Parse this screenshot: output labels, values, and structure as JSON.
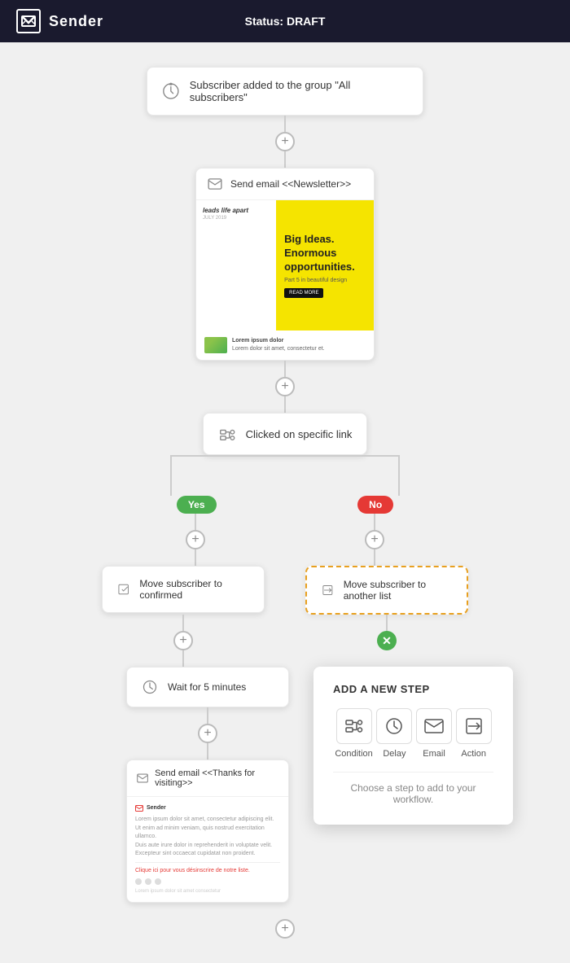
{
  "header": {
    "logo_text": "Sender",
    "status_label": "Status:",
    "status_value": "DRAFT"
  },
  "nodes": {
    "trigger": {
      "label": "Subscriber added to the group \"All subscribers\""
    },
    "send_email": {
      "label": "Send email <<Newsletter>>"
    },
    "condition": {
      "label": "Clicked on specific link"
    },
    "branch_yes": "Yes",
    "branch_no": "No",
    "move_confirmed": {
      "label": "Move subscriber to confirmed"
    },
    "move_another_list": {
      "label": "Move subscriber to another list"
    },
    "wait": {
      "label": "Wait for 5 minutes"
    },
    "send_email2": {
      "label": "Send email <<Thanks for visiting>>"
    }
  },
  "add_new_step": {
    "title": "ADD A NEW STEP",
    "steps": [
      {
        "key": "condition",
        "label": "Condition",
        "icon": "condition"
      },
      {
        "key": "delay",
        "label": "Delay",
        "icon": "delay"
      },
      {
        "key": "email",
        "label": "Email",
        "icon": "email"
      },
      {
        "key": "action",
        "label": "Action",
        "icon": "action"
      }
    ],
    "hint": "Choose a step to add to your workflow."
  },
  "email_preview": {
    "headline1": "Big Ideas.",
    "headline2": "Enormous",
    "headline3": "opportunities.",
    "subtext": "Part 5 in beautiful design",
    "cta": "READ MORE",
    "footer_text": "Lorem ipsum dolor",
    "footer_sub": "Lorem dolor sit amet, consectetur et."
  },
  "email_preview2": {
    "lines": [
      "Lorem ipsum dolor sit amet, consectetur adipiscing elit.",
      "Ut enim ad minim veniam, quis nostrud exercitation ullamco.",
      "Duis aute irure dolor in reprehenderit in voluptate velit.",
      "Excepteur sint occaecat cupidatat non proident."
    ],
    "red_link": "Clique ici pour vous désinscrire de notre liste."
  }
}
